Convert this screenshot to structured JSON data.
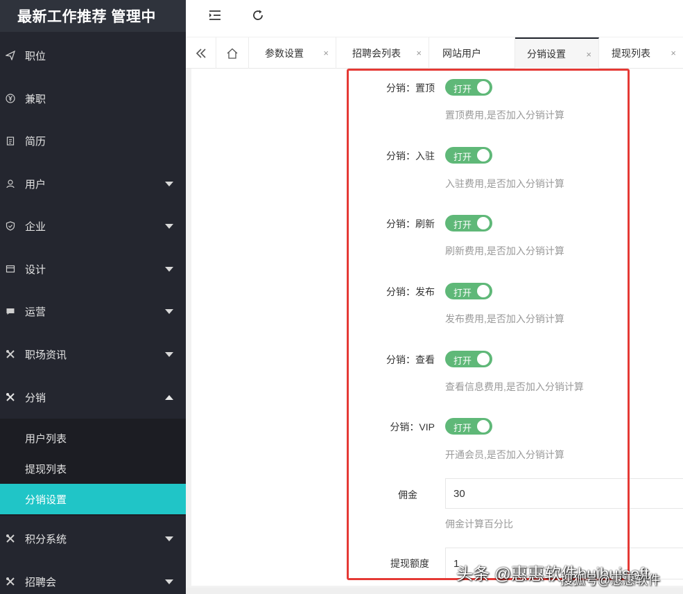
{
  "brand": {
    "title": "最新工作推荐 管理中"
  },
  "topbar": {
    "collapse_icon": "indent-icon",
    "refresh_icon": "refresh-icon"
  },
  "sidebar": {
    "items": [
      {
        "label": "职位",
        "icon": "send-icon"
      },
      {
        "label": "兼职",
        "icon": "yen-icon"
      },
      {
        "label": "简历",
        "icon": "clipboard-icon"
      },
      {
        "label": "用户",
        "icon": "user-icon"
      },
      {
        "label": "企业",
        "icon": "shield-check-icon"
      },
      {
        "label": "设计",
        "icon": "layout-icon"
      },
      {
        "label": "运营",
        "icon": "chat-icon"
      },
      {
        "label": "职场资讯",
        "icon": "tools-icon"
      },
      {
        "label": "分销",
        "icon": "tools-icon"
      },
      {
        "label": "积分系统",
        "icon": "tools-icon"
      },
      {
        "label": "招聘会",
        "icon": "tools-icon"
      }
    ],
    "subitems": [
      {
        "label": "用户列表"
      },
      {
        "label": "提现列表"
      },
      {
        "label": "分销设置"
      }
    ]
  },
  "tabs": [
    {
      "label": "参数设置"
    },
    {
      "label": "招聘会列表"
    },
    {
      "label": "网站用户"
    },
    {
      "label": "分销设置"
    },
    {
      "label": "提现列表"
    }
  ],
  "tab_close": "×",
  "form": {
    "switch_text": "打开",
    "rows": [
      {
        "label": "分销：置顶",
        "help": "置顶费用,是否加入分销计算"
      },
      {
        "label": "分销：入驻",
        "help": "入驻费用,是否加入分销计算"
      },
      {
        "label": "分销：刷新",
        "help": "刷新费用,是否加入分销计算"
      },
      {
        "label": "分销：发布",
        "help": "发布费用,是否加入分销计算"
      },
      {
        "label": "分销：查看",
        "help": "查看信息费用,是否加入分销计算"
      },
      {
        "label": "分销：VIP",
        "help": "开通会员,是否加入分销计算"
      }
    ],
    "commission": {
      "label": "佣金",
      "value": "30",
      "help": "佣金计算百分比"
    },
    "withdraw": {
      "label": "提现额度",
      "value": "1"
    }
  },
  "watermark": {
    "line1": "头条 @惠惠软件huihuisoft",
    "line2": "搜狐号@惠惠软件"
  },
  "colors": {
    "sidebar": "#24262f",
    "active": "#20c5c7",
    "switch": "#5fb878",
    "highlight": "#e53935"
  }
}
